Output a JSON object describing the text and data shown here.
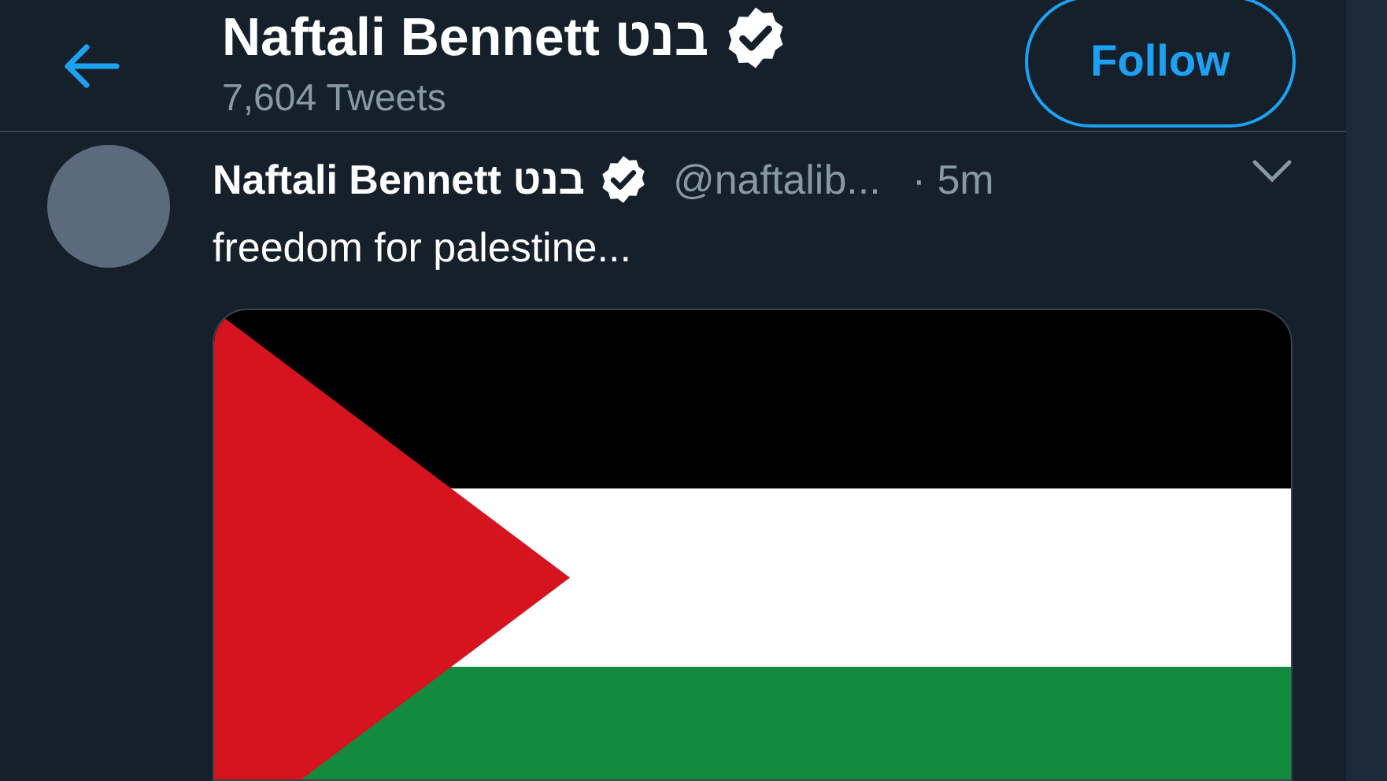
{
  "header": {
    "title": "Naftali Bennett בנט",
    "verified": true,
    "subtitle": "7,604 Tweets",
    "follow_button": "Follow"
  },
  "tweet": {
    "name": "Naftali Bennett בנט",
    "verified": true,
    "handle": "@naftalib...",
    "time": "· 5m",
    "text": "freedom for palestine..."
  }
}
